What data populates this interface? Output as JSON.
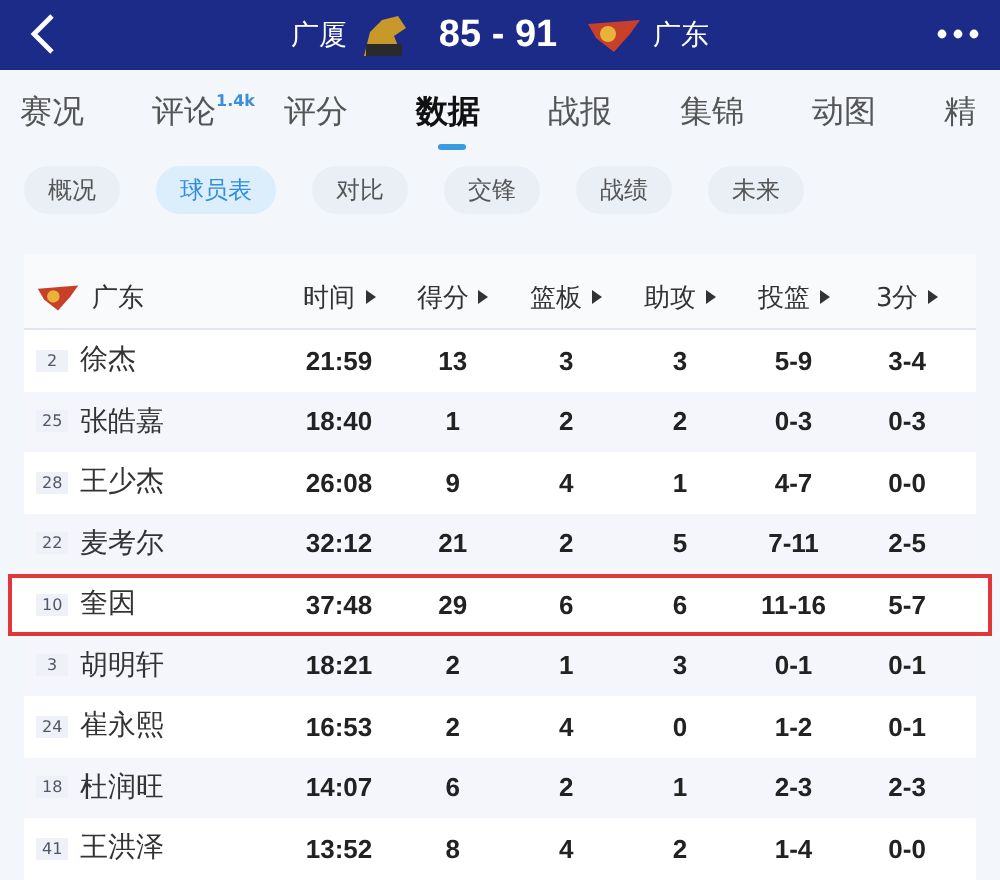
{
  "header": {
    "home_team": "广厦",
    "score": "85 - 91",
    "away_team": "广东"
  },
  "tabs": [
    {
      "label": "赛况",
      "selected": false
    },
    {
      "label": "评论",
      "badge": "1.4k",
      "selected": false
    },
    {
      "label": "评分",
      "selected": false
    },
    {
      "label": "数据",
      "selected": true
    },
    {
      "label": "战报",
      "selected": false
    },
    {
      "label": "集锦",
      "selected": false
    },
    {
      "label": "动图",
      "selected": false
    },
    {
      "label": "精",
      "selected": false
    }
  ],
  "sub_tabs": [
    {
      "label": "概况",
      "selected": false
    },
    {
      "label": "球员表",
      "selected": true
    },
    {
      "label": "对比",
      "selected": false
    },
    {
      "label": "交锋",
      "selected": false
    },
    {
      "label": "战绩",
      "selected": false
    },
    {
      "label": "未来",
      "selected": false
    }
  ],
  "table": {
    "team": "广东",
    "columns": [
      "时间",
      "得分",
      "篮板",
      "助攻",
      "投篮",
      "3分"
    ],
    "rows": [
      {
        "number": "2",
        "name": "徐杰",
        "cells": [
          "21:59",
          "13",
          "3",
          "3",
          "5-9",
          "3-4"
        ],
        "highlighted": false
      },
      {
        "number": "25",
        "name": "张皓嘉",
        "cells": [
          "18:40",
          "1",
          "2",
          "2",
          "0-3",
          "0-3"
        ],
        "highlighted": false
      },
      {
        "number": "28",
        "name": "王少杰",
        "cells": [
          "26:08",
          "9",
          "4",
          "1",
          "4-7",
          "0-0"
        ],
        "highlighted": false
      },
      {
        "number": "22",
        "name": "麦考尔",
        "cells": [
          "32:12",
          "21",
          "2",
          "5",
          "7-11",
          "2-5"
        ],
        "highlighted": false
      },
      {
        "number": "10",
        "name": "奎因",
        "cells": [
          "37:48",
          "29",
          "6",
          "6",
          "11-16",
          "5-7"
        ],
        "highlighted": true
      },
      {
        "number": "3",
        "name": "胡明轩",
        "cells": [
          "18:21",
          "2",
          "1",
          "3",
          "0-1",
          "0-1"
        ],
        "highlighted": false
      },
      {
        "number": "24",
        "name": "崔永熙",
        "cells": [
          "16:53",
          "2",
          "4",
          "0",
          "1-2",
          "0-1"
        ],
        "highlighted": false
      },
      {
        "number": "18",
        "name": "杜润旺",
        "cells": [
          "14:07",
          "6",
          "2",
          "1",
          "2-3",
          "2-3"
        ],
        "highlighted": false
      },
      {
        "number": "41",
        "name": "王洪泽",
        "cells": [
          "13:52",
          "8",
          "4",
          "2",
          "1-4",
          "0-0"
        ],
        "highlighted": false
      }
    ]
  }
}
